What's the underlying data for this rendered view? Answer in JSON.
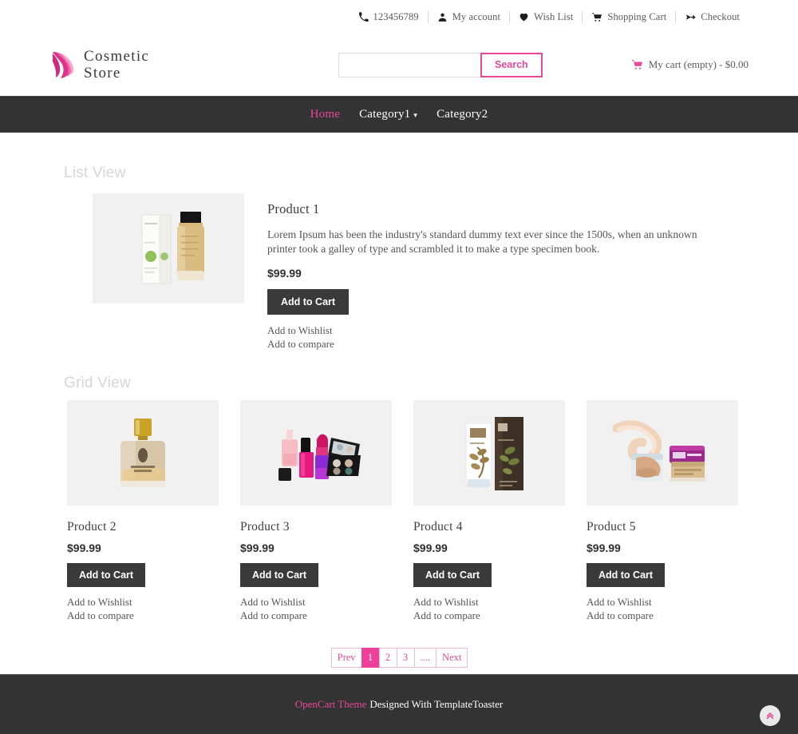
{
  "topbar": {
    "items": [
      {
        "label": "123456789",
        "icon": "phone-icon"
      },
      {
        "label": "My account",
        "icon": "user-icon"
      },
      {
        "label": "Wish List",
        "icon": "heart-icon"
      },
      {
        "label": "Shopping Cart",
        "icon": "cart-icon"
      },
      {
        "label": "Checkout",
        "icon": "arrow-icon"
      }
    ]
  },
  "header": {
    "logo_line1": "Cosmetic",
    "logo_line2": "Store",
    "logo_icon": "woman-hair-logo-icon",
    "search": {
      "value": "",
      "placeholder": "",
      "button_label": "Search"
    },
    "cart": {
      "icon": "cart-icon",
      "label": "My cart (empty) - $0.00"
    }
  },
  "nav": {
    "items": [
      {
        "label": "Home",
        "active": true,
        "caret": false
      },
      {
        "label": "Category1",
        "active": false,
        "caret": true
      },
      {
        "label": "Category2",
        "active": false,
        "caret": false
      }
    ]
  },
  "main": {
    "list_view_title": "List View",
    "grid_view_title": "Grid View",
    "list_product": {
      "name": "Product 1",
      "description": "Lorem Ipsum has been the industry's standard dummy text ever since the 1500s, when an unknown printer took a galley of type and scrambled it to make a type specimen book.",
      "price": "$99.99",
      "add_to_cart": "Add to Cart",
      "wishlist": "Add to Wishlist",
      "compare": "Add to compare",
      "image": "serum-bottle-and-box"
    },
    "grid_products": [
      {
        "name": "Product 2",
        "price": "$99.99",
        "add_to_cart": "Add to Cart",
        "wishlist": "Add to Wishlist",
        "compare": "Add to compare",
        "image": "perfume-bottle"
      },
      {
        "name": "Product 3",
        "price": "$99.99",
        "add_to_cart": "Add to Cart",
        "wishlist": "Add to Wishlist",
        "compare": "Add to compare",
        "image": "makeup-set"
      },
      {
        "name": "Product 4",
        "price": "$99.99",
        "add_to_cart": "Add to Cart",
        "wishlist": "Add to Wishlist",
        "compare": "Add to compare",
        "image": "lotion-tube-and-box"
      },
      {
        "name": "Product 5",
        "price": "$99.99",
        "add_to_cart": "Add to Cart",
        "wishlist": "Add to Wishlist",
        "compare": "Add to compare",
        "image": "cream-jar-swatch"
      }
    ],
    "pagination": [
      {
        "label": "Prev",
        "active": false
      },
      {
        "label": "1",
        "active": true
      },
      {
        "label": "2",
        "active": false
      },
      {
        "label": "3",
        "active": false
      },
      {
        "label": "....",
        "active": false
      },
      {
        "label": "Next",
        "active": false
      }
    ]
  },
  "footer": {
    "brand": "OpenCart Theme",
    "by": "Designed With TemplateToaster",
    "scroll_top_icon": "double-chevron-up-icon"
  },
  "colors": {
    "accent_pink": "#e8489b",
    "pager_active": "#ee3f99",
    "dark_bar": "#333333",
    "button_dark": "#3a3a3a",
    "thumb_bg": "#f1f1f1",
    "section_title": "#d6d6d6"
  }
}
